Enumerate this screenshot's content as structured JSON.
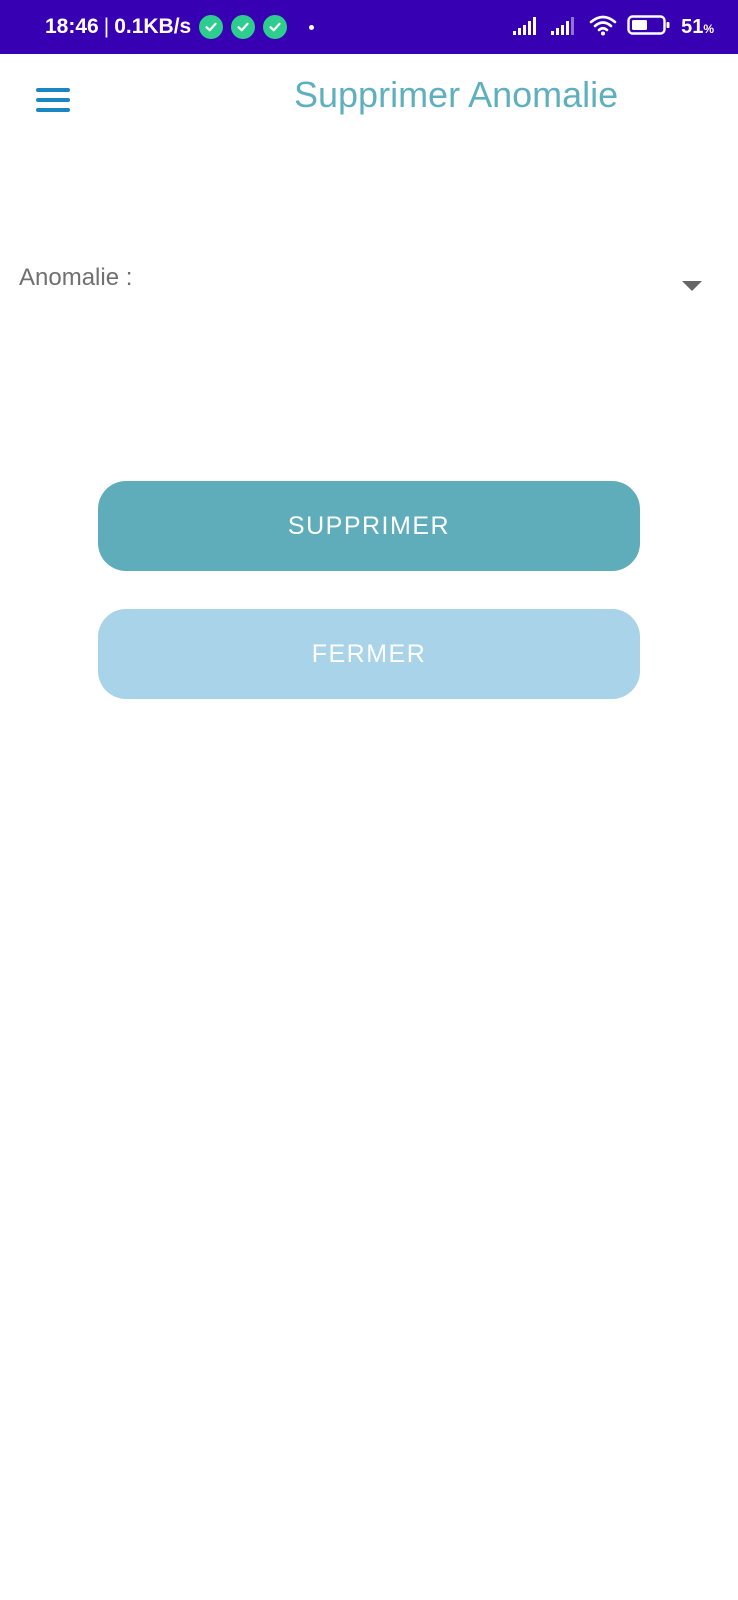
{
  "status_bar": {
    "time": "18:46",
    "separator": "|",
    "network_speed": "0.1KB/s",
    "battery_level": "51",
    "battery_unit": "%",
    "icons": [
      "check-circle-icon",
      "check-circle-icon",
      "check-circle-icon",
      "dot-icon",
      "signal-icon",
      "signal-icon",
      "wifi-icon",
      "battery-icon"
    ]
  },
  "app_bar": {
    "menu_icon": "hamburger-menu-icon",
    "title": "Supprimer Anomalie"
  },
  "form": {
    "anomalie_label": "Anomalie :",
    "anomalie_value": "",
    "dropdown_icon": "dropdown-arrow-icon"
  },
  "actions": {
    "delete_label": "SUPPRIMER",
    "close_label": "FERMER"
  },
  "colors": {
    "status_bar": "#3700b3",
    "title": "#5fb0bf",
    "menu_icon": "#1a86c4",
    "delete_button": "#5fadbb",
    "close_button": "#a8d3e8",
    "check_badge": "#2ecc8f"
  }
}
